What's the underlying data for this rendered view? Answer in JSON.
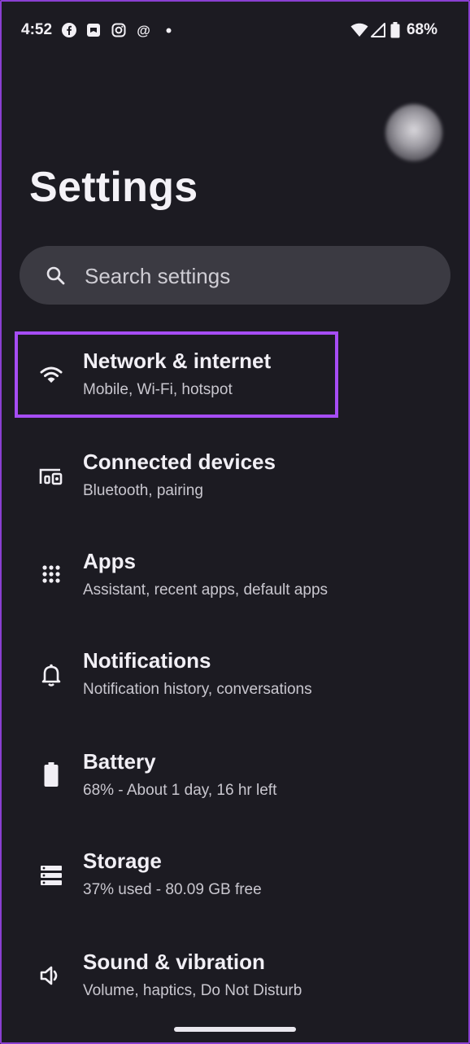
{
  "status_bar": {
    "time": "4:52",
    "notification_icons": [
      "facebook-icon",
      "messages-icon",
      "instagram-icon",
      "threads-icon",
      "dot-icon"
    ],
    "battery_percent": "68%"
  },
  "header": {
    "title": "Settings"
  },
  "search": {
    "placeholder": "Search settings"
  },
  "settings_items": [
    {
      "icon": "wifi-icon",
      "title": "Network & internet",
      "subtitle": "Mobile, Wi-Fi, hotspot",
      "highlighted": true
    },
    {
      "icon": "connected-devices-icon",
      "title": "Connected devices",
      "subtitle": "Bluetooth, pairing"
    },
    {
      "icon": "apps-grid-icon",
      "title": "Apps",
      "subtitle": "Assistant, recent apps, default apps"
    },
    {
      "icon": "bell-icon",
      "title": "Notifications",
      "subtitle": "Notification history, conversations"
    },
    {
      "icon": "battery-icon",
      "title": "Battery",
      "subtitle": "68% - About 1 day, 16 hr left"
    },
    {
      "icon": "storage-icon",
      "title": "Storage",
      "subtitle": "37% used - 80.09 GB free"
    },
    {
      "icon": "speaker-icon",
      "title": "Sound & vibration",
      "subtitle": "Volume, haptics, Do Not Disturb"
    }
  ],
  "colors": {
    "background": "#1c1b22",
    "search_bg": "#3b3a42",
    "highlight": "#a64df5"
  }
}
